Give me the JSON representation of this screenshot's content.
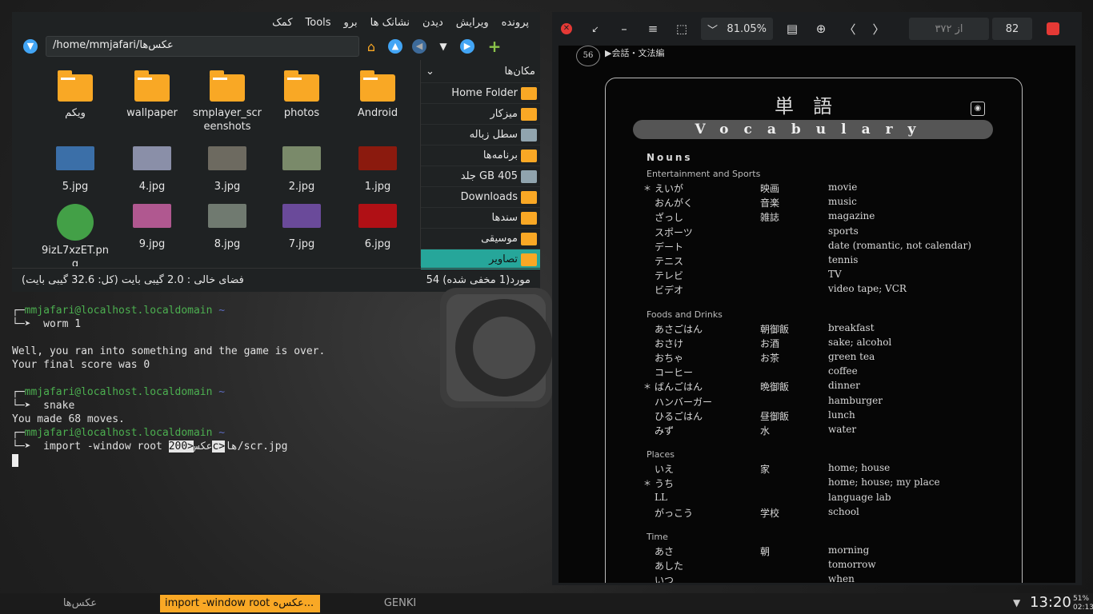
{
  "file_manager": {
    "menu": [
      "پرونده",
      "ویرایش",
      "دیدن",
      "نشانک ها",
      "برو",
      "Tools",
      "کمک"
    ],
    "path": "/home/mmjafari/عکس‌ها",
    "items": [
      {
        "name": "Android",
        "type": "folder"
      },
      {
        "name": "photos",
        "type": "folder"
      },
      {
        "name": "smplayer_screenshots",
        "type": "folder",
        "label": "smplayer_scr\neenshots"
      },
      {
        "name": "wallpaper",
        "type": "folder"
      },
      {
        "name": "ویکم",
        "type": "folder"
      },
      {
        "name": "1.jpg",
        "type": "image",
        "color": "#8b1a0e"
      },
      {
        "name": "2.jpg",
        "type": "image",
        "color": "#7a8a6a"
      },
      {
        "name": "3.jpg",
        "type": "image",
        "color": "#6d6a60"
      },
      {
        "name": "4.jpg",
        "type": "image",
        "color": "#8a8fa8"
      },
      {
        "name": "5.jpg",
        "type": "image",
        "color": "#3b6fa8"
      },
      {
        "name": "6.jpg",
        "type": "image",
        "color": "#b01015"
      },
      {
        "name": "7.jpg",
        "type": "image",
        "color": "#6a4a9a"
      },
      {
        "name": "8.jpg",
        "type": "image",
        "color": "#707a70"
      },
      {
        "name": "9.jpg",
        "type": "image",
        "color": "#b05890"
      },
      {
        "name": "9izL7xzET.png",
        "type": "image",
        "label": "9izL7xzET.pn\ng",
        "color": "#43a047"
      }
    ],
    "places_header": "مکان‌ها",
    "places": [
      {
        "label": "Home Folder"
      },
      {
        "label": "میزکار"
      },
      {
        "label": "سطل زباله"
      },
      {
        "label": "برنامه‌ها"
      },
      {
        "label": "جلد GB 405"
      },
      {
        "label": "Downloads"
      },
      {
        "label": "سندها"
      },
      {
        "label": "موسیقی"
      },
      {
        "label": "تصاویر"
      }
    ],
    "status_left": "فضای خالی : 2.0 گیبی بایت (کل: 32.6 گیبی بایت)",
    "status_right": "54 مورد(1 مخفی شده)"
  },
  "terminal": {
    "user": "mmjafari@localhost.localdomain",
    "tilde": "~",
    "cmd1": "worm 1",
    "out1": "Well, you ran into something and the game is over.",
    "out2": "Your final score was 0",
    "cmd2": "snake",
    "out3": "You made 68 moves.",
    "cmd3_a": "import -window root عکس",
    "cmd3_sel": "<200c>",
    "cmd3_b": "ها/scr.jpg"
  },
  "pdf": {
    "zoom": "81.05%",
    "page_of": "از ۳۷۲",
    "page": "82",
    "page_no": "56",
    "header": "▶会話・文法編",
    "title_jp": "単　語",
    "banner": "Vocabulary",
    "nouns": "Nouns",
    "sections": [
      {
        "title": "Entertainment and Sports",
        "rows": [
          {
            "k": "えいが",
            "kj": "映画",
            "e": "movie",
            "star": true
          },
          {
            "k": "おんがく",
            "kj": "音楽",
            "e": "music"
          },
          {
            "k": "ざっし",
            "kj": "雑誌",
            "e": "magazine"
          },
          {
            "k": "スポーツ",
            "kj": "",
            "e": "sports"
          },
          {
            "k": "デート",
            "kj": "",
            "e": "date (romantic, not calendar)"
          },
          {
            "k": "テニス",
            "kj": "",
            "e": "tennis"
          },
          {
            "k": "テレビ",
            "kj": "",
            "e": "TV"
          },
          {
            "k": "ビデオ",
            "kj": "",
            "e": "video tape; VCR"
          }
        ]
      },
      {
        "title": "Foods and Drinks",
        "rows": [
          {
            "k": "あさごはん",
            "kj": "朝御飯",
            "e": "breakfast"
          },
          {
            "k": "おさけ",
            "kj": "お酒",
            "e": "sake; alcohol"
          },
          {
            "k": "おちゃ",
            "kj": "お茶",
            "e": "green tea"
          },
          {
            "k": "コーヒー",
            "kj": "",
            "e": "coffee"
          },
          {
            "k": "ばんごはん",
            "kj": "晩御飯",
            "e": "dinner",
            "star": true
          },
          {
            "k": "ハンバーガー",
            "kj": "",
            "e": "hamburger"
          },
          {
            "k": "ひるごはん",
            "kj": "昼御飯",
            "e": "lunch"
          },
          {
            "k": "みず",
            "kj": "水",
            "e": "water"
          }
        ]
      },
      {
        "title": "Places",
        "rows": [
          {
            "k": "いえ",
            "kj": "家",
            "e": "home; house"
          },
          {
            "k": "うち",
            "kj": "",
            "e": "home; house; my place",
            "star": true
          },
          {
            "k": "LL",
            "kj": "",
            "e": "language lab"
          },
          {
            "k": "がっこう",
            "kj": "学校",
            "e": "school"
          }
        ]
      },
      {
        "title": "Time",
        "rows": [
          {
            "k": "あさ",
            "kj": "朝",
            "e": "morning"
          },
          {
            "k": "あした",
            "kj": "",
            "e": "tomorrow"
          },
          {
            "k": "いつ",
            "kj": "",
            "e": "when"
          }
        ]
      }
    ]
  },
  "taskbar": {
    "items": [
      "عکس‌ها",
      "import -window root عکس‌ه...",
      "GENKI"
    ],
    "clock": "13:20",
    "battery": "51%",
    "time_small": "02:13"
  },
  "colors": {
    "accent": "#26a69a",
    "folder": "#f9a825",
    "prompt": "#4caf50",
    "tilde": "#5c6bc0"
  }
}
